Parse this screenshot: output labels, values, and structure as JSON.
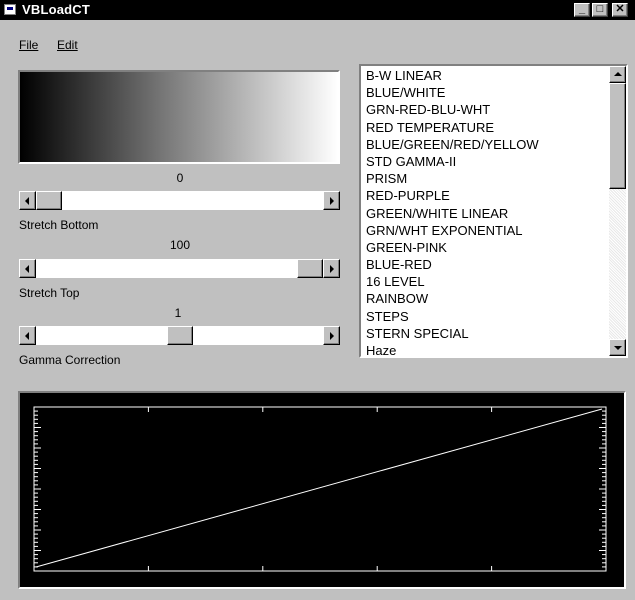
{
  "window": {
    "title": "VBLoadCT"
  },
  "menu": {
    "file": "File",
    "edit": "Edit"
  },
  "controls": {
    "stretch_bottom": {
      "value": "0",
      "label": "Stretch Bottom",
      "level": 0.0
    },
    "stretch_top": {
      "value": "100",
      "label": "Stretch Top",
      "level": 1.0
    },
    "gamma": {
      "value": "1",
      "label": "Gamma Correction",
      "level": 0.5
    }
  },
  "colortables": [
    "B-W LINEAR",
    "BLUE/WHITE",
    "GRN-RED-BLU-WHT",
    "RED TEMPERATURE",
    "BLUE/GREEN/RED/YELLOW",
    "STD GAMMA-II",
    "PRISM",
    "RED-PURPLE",
    "GREEN/WHITE LINEAR",
    "GRN/WHT EXPONENTIAL",
    "GREEN-PINK",
    "BLUE-RED",
    "16 LEVEL",
    "RAINBOW",
    "STEPS",
    "STERN SPECIAL",
    "Haze"
  ],
  "colors": {
    "titlebar": "#000000",
    "window_bg": "#c0c0c0",
    "plot_bg": "#000000",
    "plot_line": "#ffffff"
  }
}
